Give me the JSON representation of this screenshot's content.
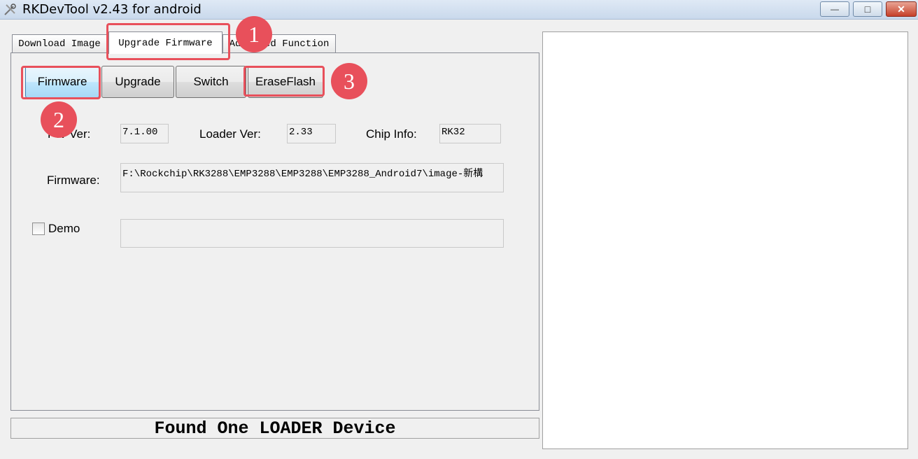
{
  "window": {
    "title": "RKDevTool v2.43 for android",
    "controls": {
      "minimize": "—",
      "maximize": "□",
      "close": "✕"
    }
  },
  "tabs": [
    {
      "label": "Download Image",
      "selected": false
    },
    {
      "label": "Upgrade Firmware",
      "selected": true
    },
    {
      "label": "Advanced Function",
      "selected": false
    }
  ],
  "toolbar": {
    "firmware_label": "Firmware",
    "upgrade_label": "Upgrade",
    "switch_label": "Switch",
    "eraseflash_label": "EraseFlash"
  },
  "info": {
    "fw_ver_label": "FW Ver:",
    "fw_ver_value": "7.1.00",
    "loader_ver_label": "Loader Ver:",
    "loader_ver_value": "2.33",
    "chip_info_label": "Chip Info:",
    "chip_info_value": "RK32",
    "firmware_label": "Firmware:",
    "firmware_path": "F:\\Rockchip\\RK3288\\EMP3288\\EMP3288\\EMP3288_Android7\\image-新構",
    "demo_label": "Demo",
    "demo_checked": false,
    "demo_value": ""
  },
  "status": {
    "text": "Found One LOADER Device"
  },
  "annotations": {
    "badge_1": "1",
    "badge_2": "2",
    "badge_3": "3",
    "color": "#e8505b"
  }
}
